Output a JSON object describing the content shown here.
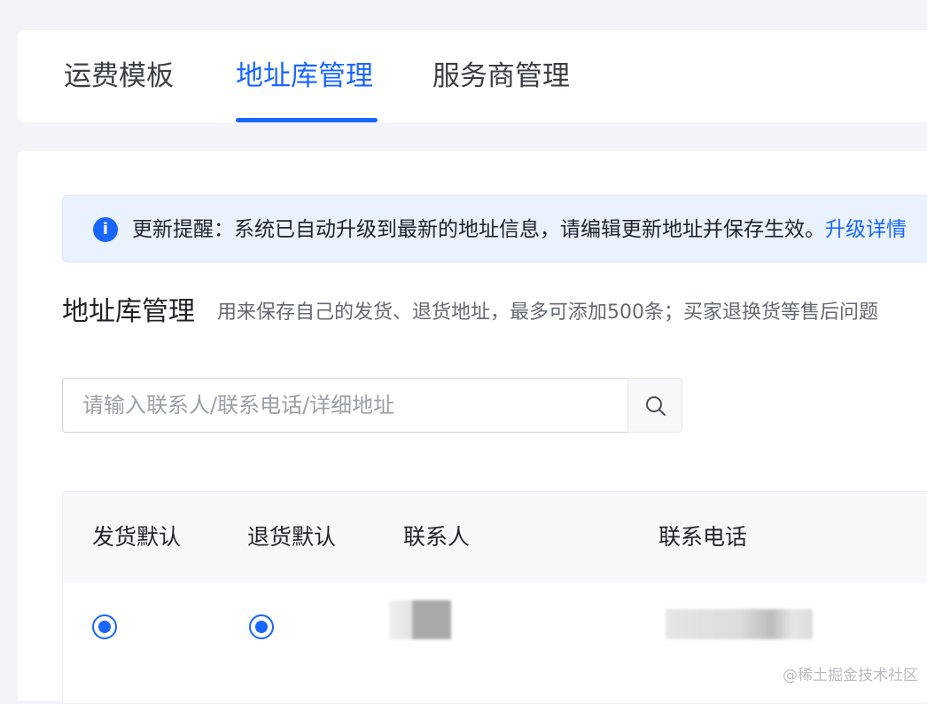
{
  "tabs": [
    {
      "label": "运费模板"
    },
    {
      "label": "地址库管理"
    },
    {
      "label": "服务商管理"
    }
  ],
  "notice": {
    "icon": "info-icon",
    "text": "更新提醒：系统已自动升级到最新的地址信息，请编辑更新地址并保存生效。",
    "link": "升级详情"
  },
  "section": {
    "title": "地址库管理",
    "description": "用来保存自己的发货、退货地址，最多可添加500条；买家退换货等售后问题"
  },
  "search": {
    "placeholder": "请输入联系人/联系电话/详细地址",
    "icon": "search-icon"
  },
  "table": {
    "columns": [
      "发货默认",
      "退货默认",
      "联系人",
      "联系电话"
    ],
    "rows": [
      {
        "ship_default": true,
        "return_default": true,
        "contact": "",
        "phone": ""
      }
    ]
  },
  "watermark": "@稀土掘金技术社区",
  "colors": {
    "accent": "#1966ff",
    "notice_bg": "#eaf2ff"
  }
}
